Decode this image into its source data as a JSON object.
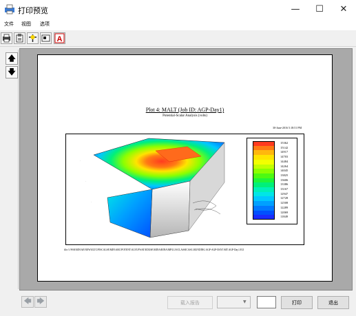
{
  "window": {
    "title": "打印预览",
    "minimize": "—",
    "maximize": "☐",
    "close": "✕"
  },
  "menu": [
    "文件",
    "视图",
    "选项"
  ],
  "toolbar": [
    "print-icon",
    "page-setup-icon",
    "crosshair-icon",
    "fit-page-icon",
    "font-icon"
  ],
  "sidebar": {
    "up": "🡅",
    "down": "🡇"
  },
  "page": {
    "title": "Plot 4:  MALT  (Job ID: AGP-Day1)",
    "subtitle": "Potential-Scalar Analysis (volts)",
    "date": "30-June-2016 5:18:51 PM",
    "file": "file:/\\//WSI\\BIN\\AE\\NEW\\ELTC\\PISCALSE\\MIN\\ARC\\POTENT\\ALYUP\\SAT\\EDUSE\\MINA\\RINA\\MP\\LUS\\CLASSICAS\\L\\RUNDING AGP-AGP-DAY1\\MT.AGP-Day1.F21",
    "legend_values": [
      "15362",
      "15142",
      "14917",
      "14703",
      "14484",
      "14264",
      "14045",
      "13825",
      "13606",
      "13386",
      "13167",
      "12947",
      "12728",
      "12508",
      "12289",
      "12069",
      "11849"
    ]
  },
  "legend_colors": [
    "#ff3b1f",
    "#ff7a14",
    "#ffb70d",
    "#ffe400",
    "#f3ff00",
    "#c2ff00",
    "#8cff00",
    "#4dfa12",
    "#1ef53a",
    "#00f07a",
    "#00f0b8",
    "#00e6e6",
    "#00c8ff",
    "#00a0ff",
    "#0078ff",
    "#0050ff",
    "#1a2cff"
  ],
  "bottom": {
    "prev": "🡄",
    "next": "🡆",
    "load_button": "载入报告",
    "combo_value": "",
    "page_value": "",
    "print_button": "打印",
    "exit_button": "退出"
  }
}
